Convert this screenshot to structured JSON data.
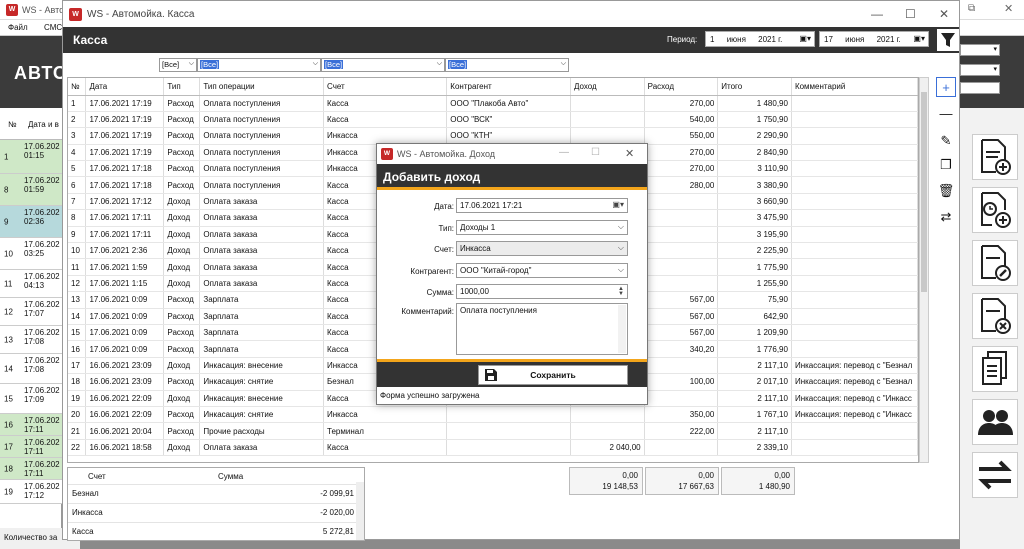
{
  "background_app": {
    "title": "WS - Автом",
    "menu": [
      "Файл",
      "СМС"
    ],
    "header_text": "АВТО",
    "list_header": {
      "no": "№",
      "date": "Дата и в"
    },
    "rows": [
      {
        "n": "1",
        "d1": "17.06.202",
        "d2": "01:15",
        "color": "#cfe8c7"
      },
      {
        "n": "8",
        "d1": "17.06.202",
        "d2": "01:59",
        "color": "#cfe8c7"
      },
      {
        "n": "9",
        "d1": "17.06.202",
        "d2": "02:36",
        "color": "#b6d9dc"
      },
      {
        "n": "10",
        "d1": "17.06.202",
        "d2": "03:25",
        "color": "#ffffff"
      },
      {
        "n": "11",
        "d1": "17.06.202",
        "d2": "04:13",
        "color": "#ffffff"
      },
      {
        "n": "12",
        "d1": "17.06.202",
        "d2": "17:07",
        "color": "#ffffff"
      },
      {
        "n": "13",
        "d1": "17.06.202",
        "d2": "17:08",
        "color": "#ffffff"
      },
      {
        "n": "14",
        "d1": "17.06.202",
        "d2": "17:08",
        "color": "#ffffff"
      },
      {
        "n": "15",
        "d1": "17.06.202",
        "d2": "17:09",
        "color": "#ffffff"
      },
      {
        "n": "16",
        "d1": "17.06.202",
        "d2": "17:11",
        "color": "#cfe8c7"
      },
      {
        "n": "17",
        "d1": "17.06.202",
        "d2": "17:11",
        "color": "#cfe8c7"
      },
      {
        "n": "18",
        "d1": "17.06.202",
        "d2": "17:11",
        "color": "#cfe8c7"
      },
      {
        "n": "19",
        "d1": "17.06.202",
        "d2": "17:12",
        "color": "#ffffff"
      }
    ],
    "status": "Количество за"
  },
  "window": {
    "title": "WS - Автомойка. Касса",
    "section_title": "Касса",
    "period_label": "Период:",
    "date_from": {
      "day": "1",
      "month": "июня",
      "year": "2021 г."
    },
    "date_to": {
      "day": "17",
      "month": "июня",
      "year": "2021 г."
    }
  },
  "filters": {
    "type": "[Все]",
    "operation": "[Все]",
    "account": "[Все]",
    "counterparty": "[Все]"
  },
  "table": {
    "headers": [
      "№",
      "Дата",
      "Тип",
      "Тип операции",
      "Счет",
      "Контрагент",
      "Доход",
      "Расход",
      "Итого",
      "Комментарий"
    ],
    "rows": [
      [
        "1",
        "17.06.2021 17:19",
        "Расход",
        "Оплата поступления",
        "Касса",
        "ООО \"Плакоба Авто\"",
        "",
        "270,00",
        "1 480,90",
        ""
      ],
      [
        "2",
        "17.06.2021 17:19",
        "Расход",
        "Оплата поступления",
        "Касса",
        "ООО \"ВСК\"",
        "",
        "540,00",
        "1 750,90",
        ""
      ],
      [
        "3",
        "17.06.2021 17:19",
        "Расход",
        "Оплата поступления",
        "Инкасса",
        "ООО \"КТН\"",
        "",
        "550,00",
        "2 290,90",
        ""
      ],
      [
        "4",
        "17.06.2021 17:19",
        "Расход",
        "Оплата поступления",
        "Инкасса",
        "ООО \"Китай-город\"",
        "",
        "270,00",
        "2 840,90",
        ""
      ],
      [
        "5",
        "17.06.2021 17:18",
        "Расход",
        "Оплата поступления",
        "Инкасса",
        "",
        "",
        "270,00",
        "3 110,90",
        ""
      ],
      [
        "6",
        "17.06.2021 17:18",
        "Расход",
        "Оплата поступления",
        "Касса",
        "",
        "",
        "280,00",
        "3 380,90",
        ""
      ],
      [
        "7",
        "17.06.2021 17:12",
        "Доход",
        "Оплата заказа",
        "Касса",
        "",
        "",
        "",
        "3 660,90",
        ""
      ],
      [
        "8",
        "17.06.2021 17:11",
        "Доход",
        "Оплата заказа",
        "Касса",
        "",
        "",
        "",
        "3 475,90",
        ""
      ],
      [
        "9",
        "17.06.2021 17:11",
        "Доход",
        "Оплата заказа",
        "Касса",
        "",
        "",
        "",
        "3 195,90",
        ""
      ],
      [
        "10",
        "17.06.2021 2:36",
        "Доход",
        "Оплата заказа",
        "Касса",
        "",
        "",
        "",
        "2 225,90",
        ""
      ],
      [
        "11",
        "17.06.2021 1:59",
        "Доход",
        "Оплата заказа",
        "Касса",
        "",
        "",
        "",
        "1 775,90",
        ""
      ],
      [
        "12",
        "17.06.2021 1:15",
        "Доход",
        "Оплата заказа",
        "Касса",
        "",
        "",
        "",
        "1 255,90",
        ""
      ],
      [
        "13",
        "17.06.2021 0:09",
        "Расход",
        "Зарплата",
        "Касса",
        "",
        "",
        "567,00",
        "75,90",
        ""
      ],
      [
        "14",
        "17.06.2021 0:09",
        "Расход",
        "Зарплата",
        "Касса",
        "",
        "",
        "567,00",
        "642,90",
        ""
      ],
      [
        "15",
        "17.06.2021 0:09",
        "Расход",
        "Зарплата",
        "Касса",
        "",
        "",
        "567,00",
        "1 209,90",
        ""
      ],
      [
        "16",
        "17.06.2021 0:09",
        "Расход",
        "Зарплата",
        "Касса",
        "",
        "",
        "340,20",
        "1 776,90",
        ""
      ],
      [
        "17",
        "16.06.2021 23:09",
        "Доход",
        "Инкасация: внесение",
        "Инкасса",
        "",
        "",
        "",
        "2 117,10",
        "Инкассация: перевод с \"Безнал"
      ],
      [
        "18",
        "16.06.2021 23:09",
        "Расход",
        "Инкасация: снятие",
        "Безнал",
        "",
        "",
        "100,00",
        "2 017,10",
        "Инкассация: перевод с \"Безнал"
      ],
      [
        "19",
        "16.06.2021 22:09",
        "Доход",
        "Инкасация: внесение",
        "Касса",
        "",
        "",
        "",
        "2 117,10",
        "Инкассация: перевод с \"Инкасс"
      ],
      [
        "20",
        "16.06.2021 22:09",
        "Расход",
        "Инкасация: снятие",
        "Инкасса",
        "",
        "",
        "350,00",
        "1 767,10",
        "Инкассация: перевод с \"Инкасс"
      ],
      [
        "21",
        "16.06.2021 20:04",
        "Расход",
        "Прочие расходы",
        "Терминал",
        "",
        "",
        "222,00",
        "2 117,10",
        ""
      ],
      [
        "22",
        "16.06.2021 18:58",
        "Доход",
        "Оплата заказа",
        "Касса",
        "",
        "2 040,00",
        "",
        "2 339,10",
        ""
      ]
    ]
  },
  "summary": {
    "headers": [
      "Счет",
      "Сумма"
    ],
    "rows": [
      [
        "Безнал",
        "-2 099,91"
      ],
      [
        "Инкасса",
        "-2 020,00"
      ],
      [
        "Касса",
        "5 272,81"
      ]
    ]
  },
  "totals": {
    "income": [
      "0,00",
      "19 148,53"
    ],
    "expense": [
      "0,00",
      "17 667,63"
    ],
    "total": [
      "0,00",
      "1 480,90"
    ]
  },
  "dialog": {
    "title": "WS - Автомойка. Доход",
    "heading": "Добавить доход",
    "labels": {
      "date": "Дата:",
      "type": "Тип:",
      "account": "Счет:",
      "counterparty": "Контрагент:",
      "amount": "Сумма:",
      "comment": "Комментарий:"
    },
    "values": {
      "date": "17.06.2021 17:21",
      "type": "Доходы 1",
      "account": "Инкасса",
      "counterparty": "ООО \"Китай-город\"",
      "amount": "1000,00",
      "comment": "Оплата поступления"
    },
    "save_label": "Сохранить",
    "status": "Форма успешно загружена"
  },
  "colors": {
    "accent": "#f3a51b",
    "dark_bar": "#333333",
    "selection": "#3a6fd8",
    "logo": "#c62828"
  }
}
